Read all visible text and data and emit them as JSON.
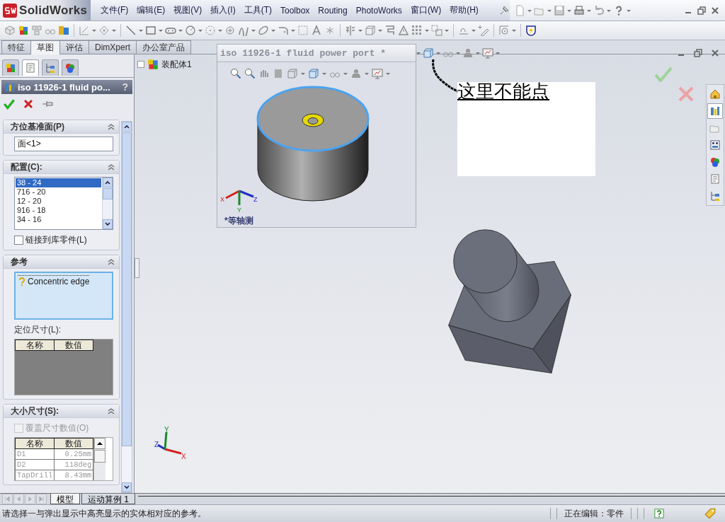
{
  "app": {
    "logo": "SolidWorks",
    "menus": [
      {
        "label": "文件(F)"
      },
      {
        "label": "编辑(E)"
      },
      {
        "label": "视图(V)"
      },
      {
        "label": "插入(I)"
      },
      {
        "label": "工具(T)"
      },
      {
        "label": "Toolbox"
      },
      {
        "label": "Routing"
      },
      {
        "label": "PhotoWorks"
      },
      {
        "label": "窗口(W)"
      },
      {
        "label": "帮助(H)"
      }
    ]
  },
  "command_tabs": [
    {
      "label": "特征",
      "selected": false
    },
    {
      "label": "草图",
      "selected": true
    },
    {
      "label": "评估",
      "selected": false
    },
    {
      "label": "DimXpert",
      "selected": false
    },
    {
      "label": "办公室产品",
      "selected": false
    }
  ],
  "property_manager": {
    "tabs": [
      {
        "selected": false
      },
      {
        "selected": true
      },
      {
        "selected": false
      },
      {
        "selected": false
      }
    ],
    "title": "iso 11926-1 fluid po...",
    "help": "?",
    "sections": [
      {
        "kind": "field",
        "title": "方位基准面(P)",
        "value": "面<1>"
      },
      {
        "kind": "list",
        "title": "配置(C):",
        "items": [
          {
            "label": "38 - 24",
            "selected": true
          },
          {
            "label": "716 - 20",
            "selected": false
          },
          {
            "label": "12 - 20",
            "selected": false
          },
          {
            "label": "916 - 18",
            "selected": false
          },
          {
            "label": "34 - 16",
            "selected": false
          }
        ],
        "checkbox": {
          "label": "链接到库零件(L)",
          "checked": false,
          "disabled": false
        }
      },
      {
        "kind": "reference",
        "title": "参考",
        "items": [
          {
            "label": "Concentric edge"
          }
        ],
        "sublabel": "定位尺寸(L):",
        "table": {
          "columns": [
            "名称",
            "数值"
          ]
        }
      },
      {
        "kind": "sizes",
        "title": "大小尺寸(S):",
        "checkbox": {
          "label": "覆盖尺寸数值(O)",
          "checked": false,
          "disabled": true
        },
        "table": {
          "columns": [
            "名称",
            "数值"
          ],
          "rows": [
            [
              "D1",
              "0.25mm"
            ],
            [
              "D2",
              "118deg"
            ],
            [
              "TapDrill",
              "8.43mm"
            ]
          ]
        }
      }
    ]
  },
  "feature_tree": {
    "root": "装配体1"
  },
  "preview": {
    "title": "iso 11926-1 fluid power port *",
    "view_label": "*等轴测",
    "triad": [
      "X",
      "Y",
      "Z"
    ]
  },
  "note": "这里不能点",
  "triad": [
    "X",
    "Y",
    "Z"
  ],
  "task_pane": [
    {
      "selected": false
    },
    {
      "selected": true
    },
    {
      "selected": false
    },
    {
      "selected": false
    },
    {
      "selected": false
    },
    {
      "selected": false
    },
    {
      "selected": false
    }
  ],
  "bottom_tabs": [
    {
      "label": "模型",
      "selected": true
    },
    {
      "label": "运动算例 1",
      "selected": false
    }
  ],
  "status_bar": {
    "message": "请选择一与弹出显示中高亮显示的实体相对应的参考。",
    "mode": "正在编辑：零件"
  }
}
